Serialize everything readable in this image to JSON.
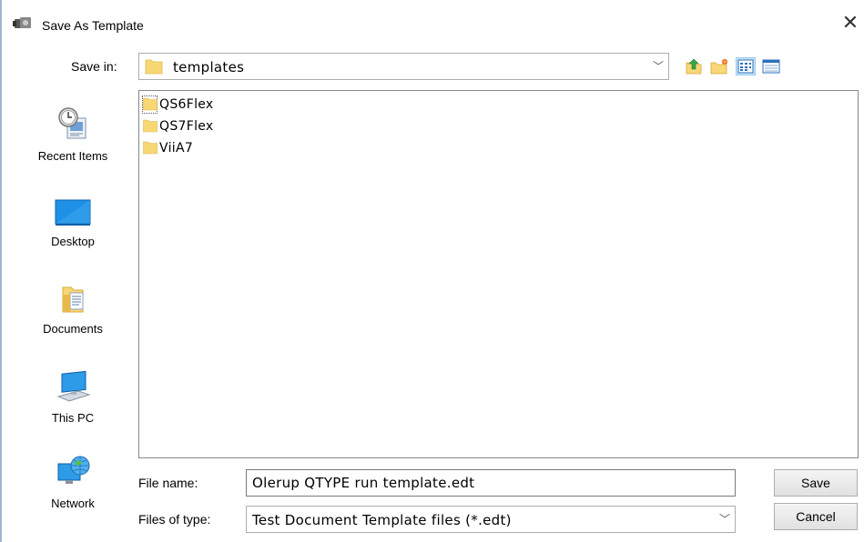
{
  "window": {
    "title": "Save As Template",
    "close_icon": "close-icon"
  },
  "save_in": {
    "label": "Save in:",
    "value": "templates"
  },
  "toolbar": {
    "icons": [
      "up-folder-icon",
      "new-folder-icon",
      "list-view-icon",
      "details-view-icon"
    ]
  },
  "places": [
    {
      "label": "Recent Items",
      "icon": "recent-items-icon"
    },
    {
      "label": "Desktop",
      "icon": "desktop-icon"
    },
    {
      "label": "Documents",
      "icon": "documents-icon"
    },
    {
      "label": "This PC",
      "icon": "this-pc-icon"
    },
    {
      "label": "Network",
      "icon": "network-icon"
    }
  ],
  "files": [
    {
      "name": "QS6Flex",
      "type": "folder",
      "selected": true
    },
    {
      "name": "QS7Flex",
      "type": "folder",
      "selected": false
    },
    {
      "name": "ViiA7",
      "type": "folder",
      "selected": false
    }
  ],
  "file_name": {
    "label": "File name:",
    "value": "Olerup QTYPE run template.edt"
  },
  "file_type": {
    "label": "Files of type:",
    "value": "Test Document Template files (*.edt)"
  },
  "buttons": {
    "save": "Save",
    "cancel": "Cancel"
  },
  "colors": {
    "folder": "#f8d775",
    "accent": "#0078d7",
    "selected_view": "#cce4f7"
  }
}
